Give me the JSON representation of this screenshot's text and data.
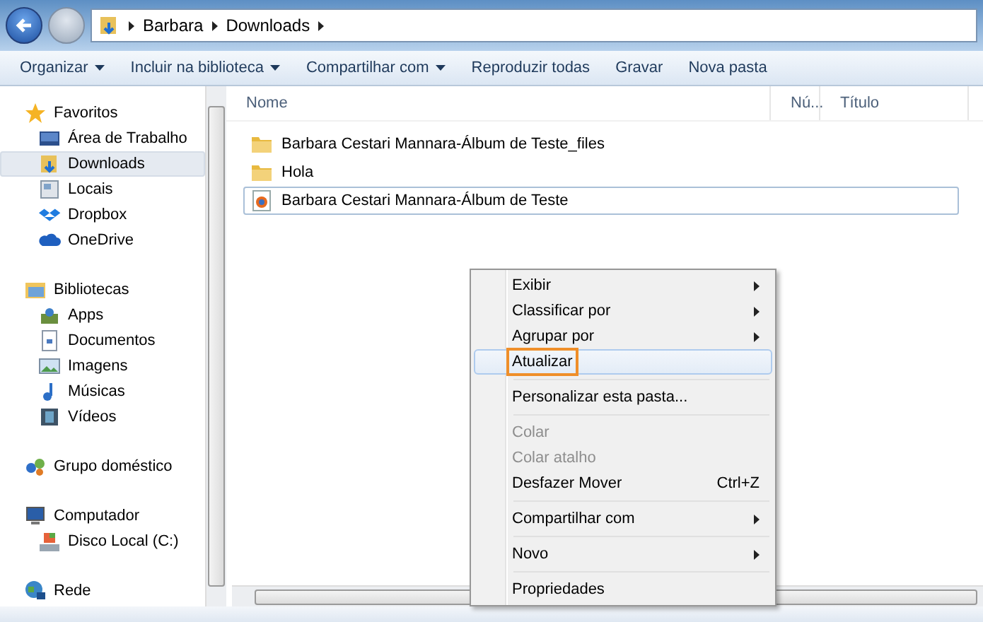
{
  "address_bar": {
    "crumbs": [
      "Barbara",
      "Downloads"
    ]
  },
  "toolbar": [
    {
      "label": "Organizar",
      "dropdown": true
    },
    {
      "label": "Incluir na biblioteca",
      "dropdown": true
    },
    {
      "label": "Compartilhar com",
      "dropdown": true
    },
    {
      "label": "Reproduzir todas",
      "dropdown": false
    },
    {
      "label": "Gravar",
      "dropdown": false
    },
    {
      "label": "Nova pasta",
      "dropdown": false
    }
  ],
  "sidebar": [
    {
      "label": "Favoritos",
      "children": [
        {
          "label": "Área de Trabalho",
          "selected": false
        },
        {
          "label": "Downloads",
          "selected": true
        },
        {
          "label": "Locais",
          "selected": false
        },
        {
          "label": "Dropbox",
          "selected": false
        },
        {
          "label": "OneDrive",
          "selected": false
        }
      ]
    },
    {
      "label": "Bibliotecas",
      "children": [
        {
          "label": "Apps",
          "selected": false
        },
        {
          "label": "Documentos",
          "selected": false
        },
        {
          "label": "Imagens",
          "selected": false
        },
        {
          "label": "Músicas",
          "selected": false
        },
        {
          "label": "Vídeos",
          "selected": false
        }
      ]
    },
    {
      "label": "Grupo doméstico"
    },
    {
      "label": "Computador",
      "children": [
        {
          "label": "Disco Local (C:)",
          "selected": false
        }
      ]
    },
    {
      "label": "Rede"
    }
  ],
  "columns": [
    "Nome",
    "Nú...",
    "Título"
  ],
  "files": [
    {
      "name": "Barbara Cestari Mannara-Álbum de Teste_files",
      "kind": "folder",
      "selected": false
    },
    {
      "name": "Hola",
      "kind": "folder",
      "selected": false
    },
    {
      "name": "Barbara Cestari Mannara-Álbum de Teste",
      "kind": "html",
      "selected": true
    }
  ],
  "context_menu": [
    {
      "kind": "item",
      "label": "Exibir",
      "submenu": true,
      "disabled": false,
      "selected": false,
      "outlined": false
    },
    {
      "kind": "item",
      "label": "Classificar por",
      "submenu": true,
      "disabled": false,
      "selected": false,
      "outlined": false
    },
    {
      "kind": "item",
      "label": "Agrupar por",
      "submenu": true,
      "disabled": false,
      "selected": false,
      "outlined": false
    },
    {
      "kind": "item",
      "label": "Atualizar",
      "submenu": false,
      "disabled": false,
      "selected": true,
      "outlined": true
    },
    {
      "kind": "separator"
    },
    {
      "kind": "item",
      "label": "Personalizar esta pasta...",
      "submenu": false,
      "disabled": false,
      "selected": false,
      "outlined": false
    },
    {
      "kind": "separator"
    },
    {
      "kind": "item",
      "label": "Colar",
      "submenu": false,
      "disabled": true,
      "selected": false,
      "outlined": false
    },
    {
      "kind": "item",
      "label": "Colar atalho",
      "submenu": false,
      "disabled": true,
      "selected": false,
      "outlined": false
    },
    {
      "kind": "item",
      "label": "Desfazer Mover",
      "shortcut": "Ctrl+Z",
      "submenu": false,
      "disabled": false,
      "selected": false,
      "outlined": false
    },
    {
      "kind": "separator"
    },
    {
      "kind": "item",
      "label": "Compartilhar com",
      "submenu": true,
      "disabled": false,
      "selected": false,
      "outlined": false
    },
    {
      "kind": "separator"
    },
    {
      "kind": "item",
      "label": "Novo",
      "submenu": true,
      "disabled": false,
      "selected": false,
      "outlined": false
    },
    {
      "kind": "separator"
    },
    {
      "kind": "item",
      "label": "Propriedades",
      "submenu": false,
      "disabled": false,
      "selected": false,
      "outlined": false
    }
  ]
}
